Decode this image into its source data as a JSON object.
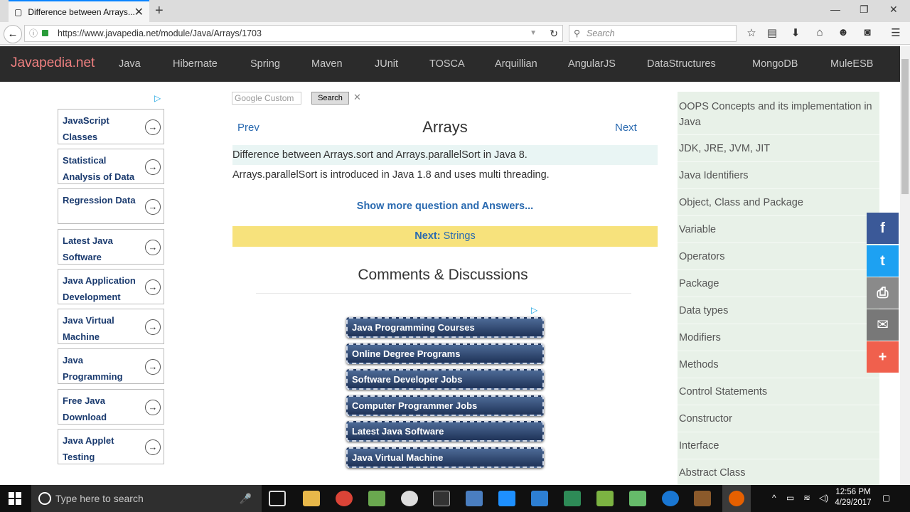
{
  "browser": {
    "tab_title": "Difference between Arrays...",
    "url": "https://www.javapedia.net/module/Java/Arrays/1703",
    "search_placeholder": "Search"
  },
  "site": {
    "brand": "Javapedia.net",
    "nav": [
      "Java",
      "Hibernate",
      "Spring",
      "Maven",
      "JUnit",
      "TOSCA",
      "Arquillian",
      "AngularJS",
      "DataStructures",
      "MongoDB",
      "MuleESB"
    ]
  },
  "left_ads": [
    "JavaScript Classes",
    "Statistical Analysis of Data",
    "Regression Data",
    "Latest Java Software",
    "Java Application Development",
    "Java Virtual Machine",
    "Java Programming",
    "Free Java Download",
    "Java Applet Testing"
  ],
  "main": {
    "google_search_placeholder": "Google  Custom",
    "search_button": "Search",
    "prev": "Prev",
    "title": "Arrays",
    "next": "Next",
    "question": "Difference between Arrays.sort and Arrays.parallelSort in Java 8.",
    "answer": "Arrays.parallelSort is introduced in Java 1.8 and uses multi threading.",
    "show_more": "Show more question and Answers...",
    "next_bar_label": "Next:",
    "next_bar_target": "Strings",
    "comments_heading": "Comments & Discussions"
  },
  "mid_ads": [
    "Java Programming Courses",
    "Online Degree Programs",
    "Software Developer Jobs",
    "Computer Programmer Jobs",
    "Latest Java Software",
    "Java Virtual Machine"
  ],
  "sidebar": [
    "OOPS Concepts and its implementation in Java",
    "JDK, JRE, JVM, JIT",
    "Java Identifiers",
    "Object, Class and Package",
    "Variable",
    "Operators",
    "Package",
    "Data types",
    "Modifiers",
    "Methods",
    "Control Statements",
    "Constructor",
    "Interface",
    "Abstract Class"
  ],
  "share": [
    {
      "icon": "facebook-icon",
      "glyph": "f",
      "color": "#3b5998"
    },
    {
      "icon": "twitter-icon",
      "glyph": "t",
      "color": "#1da1f2"
    },
    {
      "icon": "print-icon",
      "glyph": "⎙",
      "color": "#8a8a8a"
    },
    {
      "icon": "email-icon",
      "glyph": "✉",
      "color": "#787878"
    },
    {
      "icon": "plus-icon",
      "glyph": "+",
      "color": "#f0604d"
    }
  ],
  "taskbar": {
    "search_placeholder": "Type here to search",
    "time": "12:56 PM",
    "date": "4/29/2017"
  }
}
